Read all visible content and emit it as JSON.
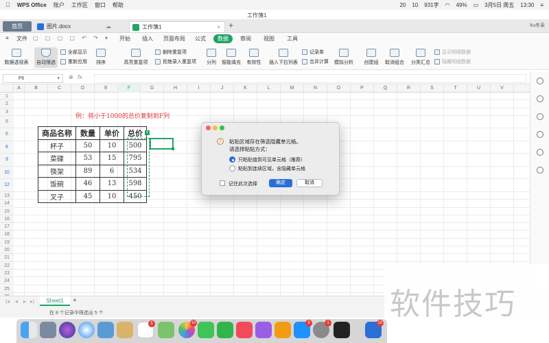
{
  "menubar": {
    "app_name": "WPS Office",
    "menus": [
      "账户",
      "工作区",
      "窗口",
      "帮助"
    ],
    "status_items": [
      "20",
      "10",
      "931字",
      "49%",
      "3月5日 周五",
      "13:30"
    ]
  },
  "window": {
    "title": "工作簿1"
  },
  "tabs": {
    "home": "首页",
    "docx": "图片.docx",
    "xlsx": "工作簿1",
    "user": "Xu冬采"
  },
  "ribbon": {
    "file": "文件",
    "tabs": [
      "开始",
      "插入",
      "页面布局",
      "公式",
      "数据",
      "审阅",
      "视图",
      "工具"
    ],
    "active_tab": "数据",
    "buttons": {
      "pivot": "数据透视表",
      "autofilter": "自动筛选",
      "show_all": "全部显示",
      "reapply": "重新应用",
      "sort": "排序",
      "highlight_dup": "高亮重复项",
      "remove_dup": "删除重复项",
      "reject_dup": "拒绝录入重复项",
      "split": "分列",
      "smart_fill": "智能填充",
      "validity": "有效性",
      "dropdown": "插入下拉列表",
      "record": "记录单",
      "consolidate": "合并计算",
      "analysis": "模拟分析",
      "group": "创建组",
      "ungroup": "取消组合",
      "subtotal": "分类汇总",
      "show_detail": "显示明细数据",
      "hide_detail": "隐藏明细数据"
    }
  },
  "formula_bar": {
    "cell_ref": "F6",
    "fx": "fx"
  },
  "columns": [
    "A",
    "B",
    "C",
    "D",
    "E",
    "F",
    "G",
    "H",
    "I",
    "J",
    "K",
    "L",
    "M",
    "N",
    "O",
    "P",
    "Q",
    "R",
    "S",
    "T",
    "U",
    "V"
  ],
  "rows": [
    "1",
    "2",
    "3",
    "5",
    "6",
    "8",
    "9",
    "10",
    "12",
    "13",
    "14",
    "15",
    "16",
    "17",
    "18",
    "19",
    "20",
    "21",
    "22",
    "23",
    "24",
    "25",
    "26",
    "27",
    "28",
    "29",
    "30"
  ],
  "note": "例：将小于1000的总价复制到F列",
  "table": {
    "headers": [
      "商品名称",
      "数量",
      "单价",
      "总价"
    ],
    "rows": [
      [
        "杯子",
        "50",
        "10",
        "500"
      ],
      [
        "菜碟",
        "53",
        "15",
        "795"
      ],
      [
        "筷架",
        "89",
        "6",
        "534"
      ],
      [
        "饭碗",
        "46",
        "13",
        "598"
      ],
      [
        "叉子",
        "45",
        "10",
        "450"
      ]
    ]
  },
  "dialog": {
    "message_line1": "粘贴区域存在筛选隐藏单元格。",
    "message_line2": "请选择粘贴方式：",
    "option1": "只粘贴值到可见单元格（推荐）",
    "option2": "粘贴到连续区域，含隐藏单元格",
    "remember": "记住此次选择",
    "ok": "确定",
    "cancel": "取消"
  },
  "sheet": {
    "name": "Sheet1"
  },
  "status": "在 8 个记录中筛选出 5 个",
  "watermark": "软件技巧",
  "dock_badges": [
    "5",
    "10",
    "9",
    "1",
    "10"
  ],
  "colors": {
    "accent": "#21a366",
    "note_red": "#e03b3b",
    "primary_blue": "#2a6fd6"
  }
}
